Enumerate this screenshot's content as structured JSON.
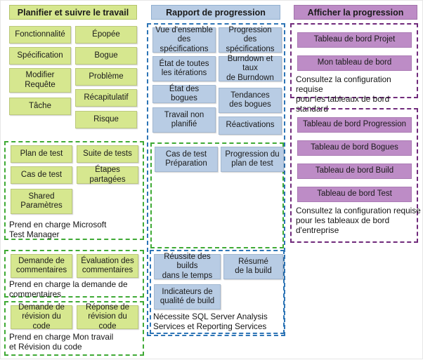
{
  "colors": {
    "green_fill": "#d6e78f",
    "blue_fill": "#b8cce4",
    "purple_fill": "#bd8cc6",
    "green_dash": "#3faa35",
    "blue_dash": "#2e75b6",
    "purple_dash": "#702a7b",
    "page_bg": "#ffffff"
  },
  "columns": {
    "plan": {
      "header": "Planifier et suivre le travail",
      "groups": [
        {
          "name": "work-items",
          "border": "none",
          "boxes": [
            "Fonctionnalité",
            "Épopée",
            "Spécification",
            "Bogue",
            "Modifier\nRequête",
            "Problème",
            "Récapitulatif",
            "Tâche",
            "Risque"
          ]
        },
        {
          "name": "test-management",
          "border": "green-dashed",
          "boxes": [
            "Plan de test",
            "Suite de tests",
            "Cas de test",
            "Étapes partagées",
            "Shared\nParamètres"
          ],
          "note": "Prend en charge Microsoft\nTest Manager"
        },
        {
          "name": "feedback",
          "border": "green-dashed",
          "boxes": [
            "Demande de\ncommentaires",
            "Évaluation des\ncommentaires"
          ],
          "note": "Prend en charge la demande de\ncommentaires"
        },
        {
          "name": "code-review",
          "border": "green-dashed",
          "boxes": [
            "Demande de\nrévision du code",
            "Réponse de\nrévision du code"
          ],
          "note": "Prend en charge Mon travail\net Révision du code"
        }
      ]
    },
    "report": {
      "header": "Rapport de progression",
      "groups": [
        {
          "name": "progress-reports",
          "border": "blue-dashed",
          "boxes": [
            "Vue d'ensemble\ndes spécifications",
            "Progression des\nspécifications",
            "État de toutes\nles itérations",
            "Burndown et taux\nde Burndown",
            "État des bogues",
            "Tendances\ndes bogues",
            "Travail non\nplanifié",
            "Réactivations"
          ]
        },
        {
          "name": "test-reports",
          "border": "green-dashed",
          "boxes": [
            "Cas de test\nPréparation",
            "Progression du\nplan de test"
          ]
        },
        {
          "name": "build-reports",
          "border": "blue-dashed",
          "boxes": [
            "Réussite des builds\ndans le temps",
            "Résumé\nde la build",
            "Indicateurs de\nqualité de build"
          ],
          "note": "Nécessite SQL Server Analysis\nServices et Reporting Services"
        }
      ]
    },
    "view": {
      "header": "Afficher la progression",
      "groups": [
        {
          "name": "standard-dashboards",
          "border": "purple-dashed",
          "boxes": [
            "Tableau de bord Projet",
            "Mon tableau de bord"
          ],
          "note": "Consultez la configuration requise\npour les tableaux de bord standard"
        },
        {
          "name": "enterprise-dashboards",
          "border": "purple-dashed",
          "boxes": [
            "Tableau de bord Progression",
            "Tableau de bord Bogues",
            "Tableau de bord Build",
            "Tableau de bord Test"
          ],
          "note": "Consultez la configuration requise\npour les tableaux de bord\nd'entreprise"
        }
      ]
    }
  }
}
